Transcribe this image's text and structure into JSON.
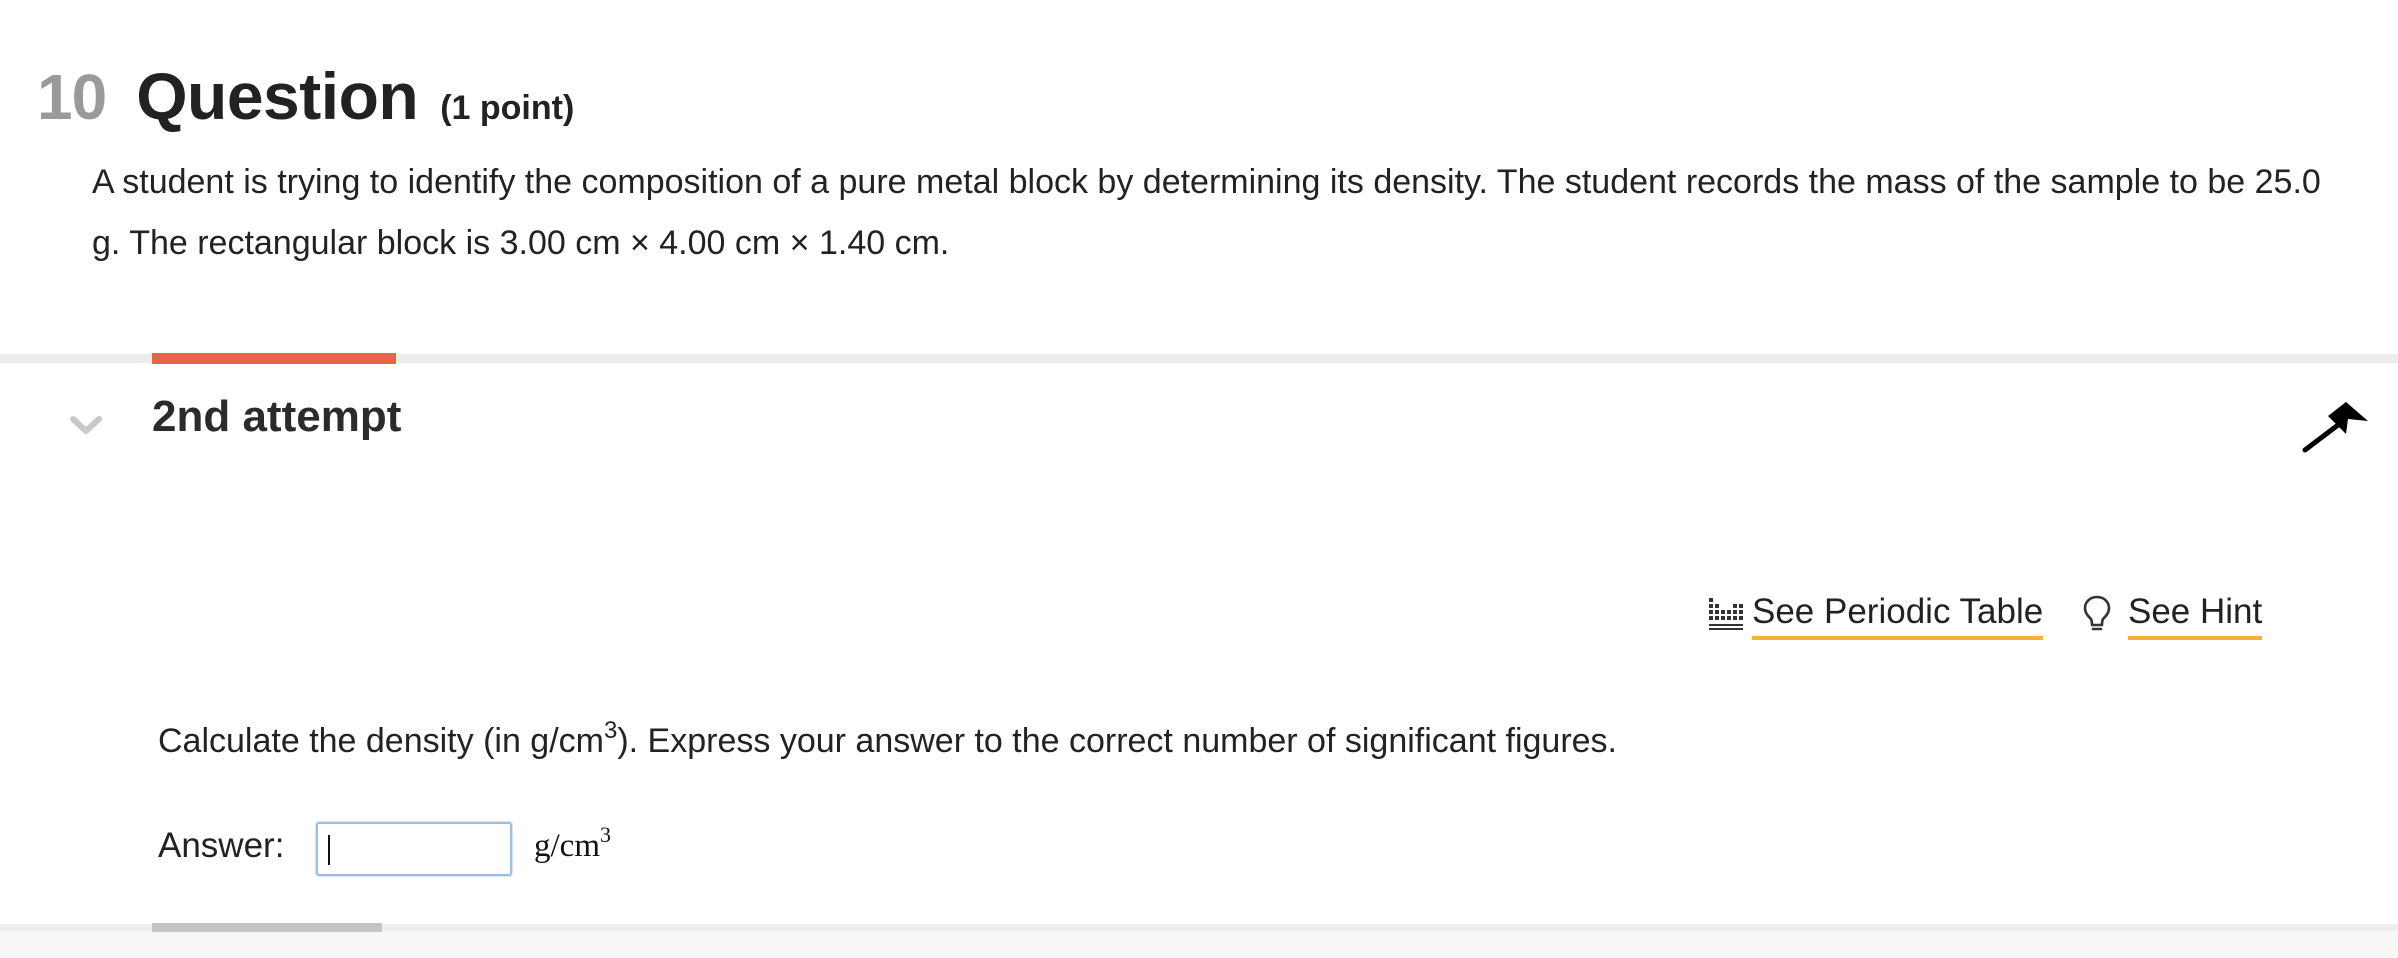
{
  "question": {
    "number": "10",
    "title": "Question",
    "points": "(1 point)",
    "prompt": "A student is trying to identify the composition of a pure metal block by determining its density. The student records the mass of the sample to be 25.0 g. The rectangular block is 3.00 cm × 4.00 cm × 1.40 cm."
  },
  "attempt": {
    "title": "2nd attempt",
    "collapse_icon": "chevron-down-icon",
    "flag_icon": "flag-icon"
  },
  "tools": {
    "periodic_table_label": "See Periodic Table",
    "periodic_table_icon": "periodic-table-icon",
    "hint_label": "See Hint",
    "hint_icon": "lightbulb-icon"
  },
  "part": {
    "instruction_before": "Calculate the density (in g/cm",
    "instruction_sup": "3",
    "instruction_after": "). Express your answer to the correct number of significant figures.",
    "answer_label": "Answer:",
    "answer_value": "",
    "unit_base": "g/cm",
    "unit_sup": "3"
  },
  "colors": {
    "accent_progress": "#e46548",
    "tool_underline": "#f2b233",
    "question_number": "#9a9a9a",
    "input_border": "#9fbce4"
  }
}
